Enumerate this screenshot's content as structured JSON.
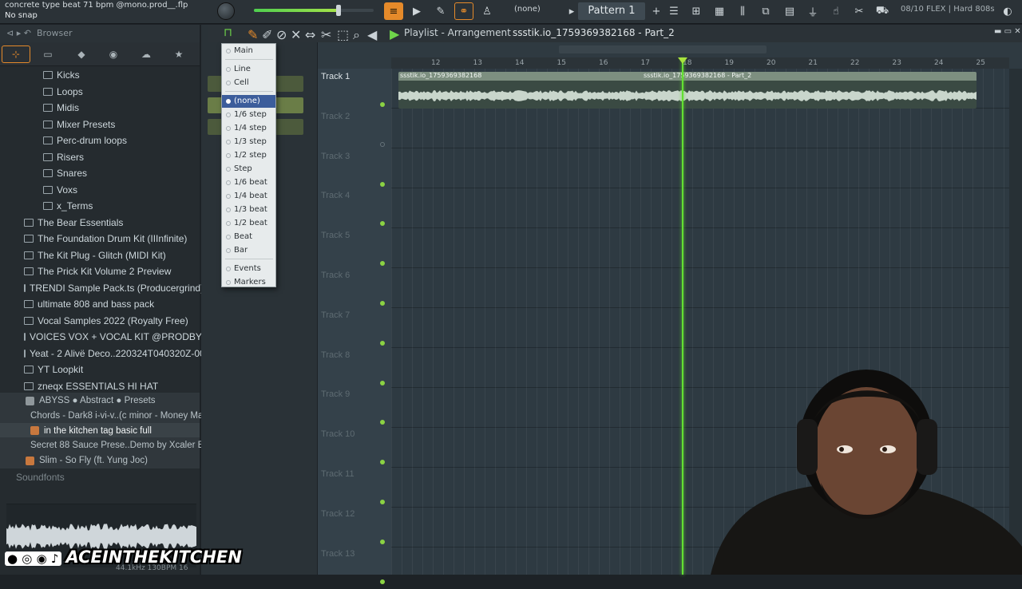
{
  "topbar": {
    "window_title": "concrete type beat 71 bpm @mono.prod__.flp",
    "hint": "No snap",
    "snap_value": "(none)",
    "pattern": "Pattern 1",
    "cpu_info": "08/10  FLEX | Hard 808s"
  },
  "browser": {
    "header": "Browser",
    "folders": [
      {
        "label": "Kicks",
        "indent": 1
      },
      {
        "label": "Loops",
        "indent": 1
      },
      {
        "label": "Midis",
        "indent": 1
      },
      {
        "label": "Mixer Presets",
        "indent": 1
      },
      {
        "label": "Perc-drum loops",
        "indent": 1
      },
      {
        "label": "Risers",
        "indent": 1
      },
      {
        "label": "Snares",
        "indent": 1
      },
      {
        "label": "Voxs",
        "indent": 1
      },
      {
        "label": "x_Terms",
        "indent": 1
      },
      {
        "label": "The Bear Essentials",
        "indent": 0
      },
      {
        "label": "The Foundation Drum Kit (IIInfinite)",
        "indent": 0
      },
      {
        "label": "The Kit Plug - Glitch (MIDI Kit)",
        "indent": 0
      },
      {
        "label": "The Prick Kit Volume 2 Preview",
        "indent": 0
      },
      {
        "label": "TRENDI Sample Pack.ts (Producergrind)",
        "indent": 0
      },
      {
        "label": "ultimate 808 and bass pack",
        "indent": 0
      },
      {
        "label": "Vocal Samples 2022 (Royalty Free)",
        "indent": 0
      },
      {
        "label": "VOICES VOX + VOCAL KIT @PRODBYLJS",
        "indent": 0
      },
      {
        "label": "Yeat - 2 Alivë Deco..220324T040320Z-001",
        "indent": 0
      },
      {
        "label": "YT Loopkit",
        "indent": 0
      },
      {
        "label": "zneqx ESSENTIALS HI HAT",
        "indent": 0
      }
    ],
    "files": [
      {
        "label": "ABYSS ● Abstract ● Presets",
        "selected": false,
        "icon_color": "#8f979b"
      },
      {
        "label": "Chords - Dark8 i-vi-v..(c minor - Money Man)",
        "selected": false,
        "icon_color": "#8f979b"
      },
      {
        "label": "in the kitchen tag basic full",
        "selected": true,
        "icon_color": "#c8783e"
      },
      {
        "label": "Secret 88 Sauce Prese..Demo by Xcaler Beats",
        "selected": false,
        "icon_color": "#8f979b"
      },
      {
        "label": "Slim - So Fly (ft. Yung Joc)",
        "selected": false,
        "icon_color": "#c8783e"
      }
    ],
    "soundfonts": "Soundfonts",
    "sample_info": "44.1kHz 130BPM 16"
  },
  "snap_menu": {
    "items": [
      {
        "label": "Main",
        "selected": false
      },
      {
        "label": "Line",
        "selected": false
      },
      {
        "label": "Cell",
        "selected": false
      },
      {
        "label": "(none)",
        "selected": true
      },
      {
        "label": "1/6 step",
        "selected": false
      },
      {
        "label": "1/4 step",
        "selected": false
      },
      {
        "label": "1/3 step",
        "selected": false
      },
      {
        "label": "1/2 step",
        "selected": false
      },
      {
        "label": "Step",
        "selected": false
      },
      {
        "label": "1/6 beat",
        "selected": false
      },
      {
        "label": "1/4 beat",
        "selected": false
      },
      {
        "label": "1/3 beat",
        "selected": false
      },
      {
        "label": "1/2 beat",
        "selected": false
      },
      {
        "label": "Beat",
        "selected": false
      },
      {
        "label": "Bar",
        "selected": false
      },
      {
        "label": "Events",
        "selected": false
      },
      {
        "label": "Markers",
        "selected": false
      }
    ]
  },
  "playlist": {
    "title": "Playlist - Arrangement",
    "pattern_name": "ssstik.io_1759369382168 - Part_2",
    "bars": [
      "12",
      "13",
      "14",
      "15",
      "16",
      "17",
      "18",
      "19",
      "20",
      "21",
      "22",
      "23",
      "24",
      "25"
    ],
    "tracks": [
      "Track 1",
      "Track 2",
      "Track 3",
      "Track 4",
      "Track 5",
      "Track 6",
      "Track 7",
      "Track 8",
      "Track 9",
      "Track 10",
      "Track 11",
      "Track 12",
      "Track 13"
    ],
    "clip1_label": "ssstik.io_1759369382168",
    "clip2_label": "ssstik.io_1759369382168 - Part_2"
  },
  "watermark": "ACEINTHEKITCHEN"
}
